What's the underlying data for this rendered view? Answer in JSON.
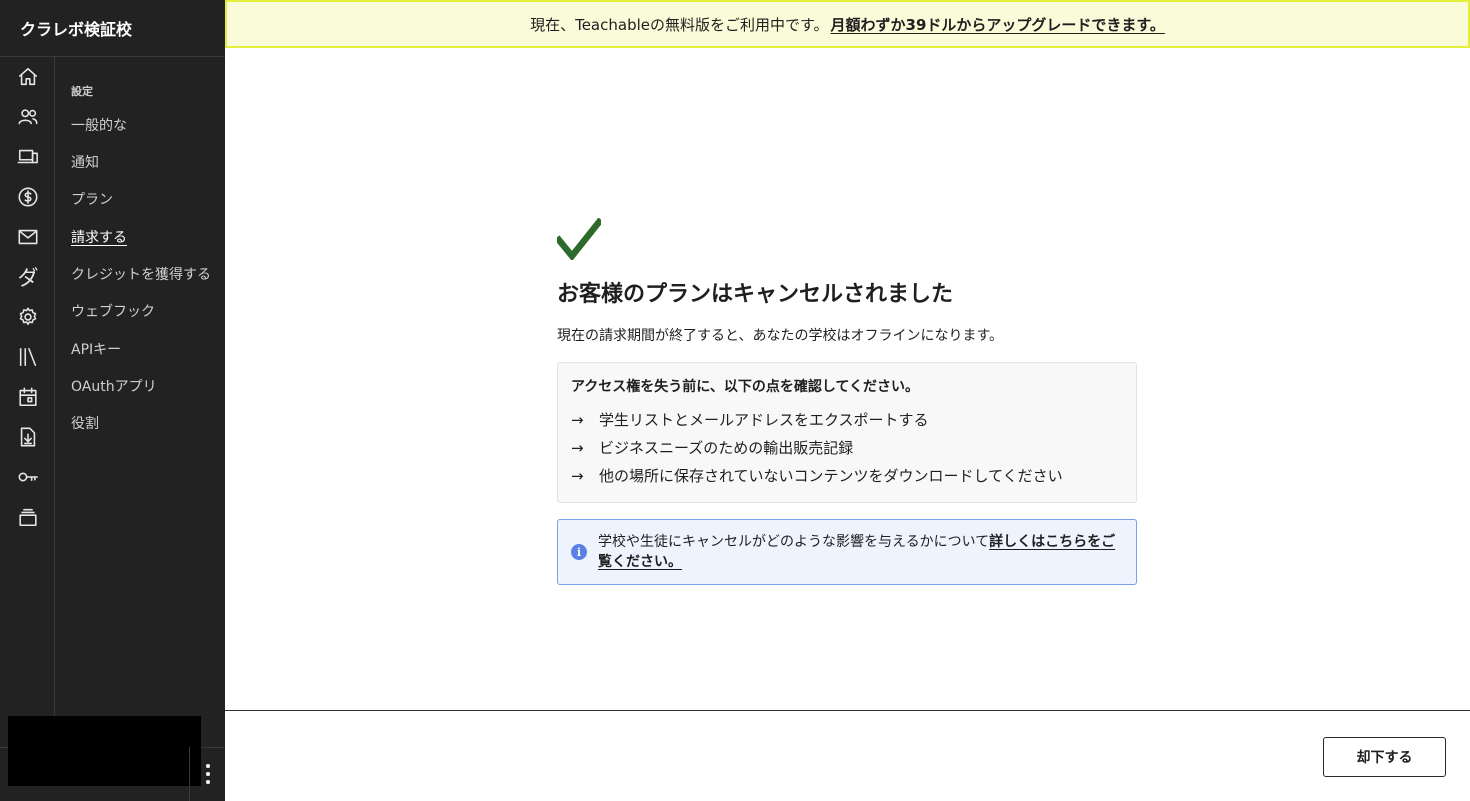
{
  "sidebar": {
    "brand": "クラレボ検証校",
    "icons": [
      "home-icon",
      "users-icon",
      "devices-icon",
      "dollar-icon",
      "mail-icon",
      "da-icon",
      "settings-icon",
      "library-icon",
      "calendar-icon",
      "download-icon",
      "key-icon",
      "stack-icon"
    ],
    "da_glyph": "ダ",
    "settings": {
      "heading": "設定",
      "items": [
        {
          "label": "一般的な"
        },
        {
          "label": "通知"
        },
        {
          "label": "プラン"
        },
        {
          "label": "請求する",
          "active": true
        },
        {
          "label": "クレジットを獲得する"
        },
        {
          "label": "ウェブフック"
        },
        {
          "label": "APIキー"
        },
        {
          "label": "OAuthアプリ"
        },
        {
          "label": "役割"
        }
      ]
    }
  },
  "banner": {
    "text": "現在、Teachableの無料版をご利用中です。",
    "link": "月額わずか39ドルからアップグレードできます。"
  },
  "main": {
    "title": "お客様のプランはキャンセルされました",
    "subtitle": "現在の請求期間が終了すると、あなたの学校はオフラインになります。",
    "checklist": {
      "title": "アクセス権を失う前に、以下の点を確認してください。",
      "arrow": "→",
      "items": [
        "学生リストとメールアドレスをエクスポートする",
        "ビジネスニーズのための輸出販売記録",
        "他の場所に保存されていないコンテンツをダウンロードしてください"
      ]
    },
    "info": {
      "icon_glyph": "i",
      "text": "学校や生徒にキャンセルがどのような影響を与えるかについて",
      "link": "詳しくはこちらをご覧ください。"
    }
  },
  "footer": {
    "dismiss_label": "却下する"
  },
  "colors": {
    "sidebar_bg": "#222222",
    "banner_bg": "#fafbd8",
    "banner_border": "#e3ef3a",
    "check_green": "#2d6a2b",
    "info_bg": "#eef3fe",
    "info_border": "#7ea0e8"
  }
}
